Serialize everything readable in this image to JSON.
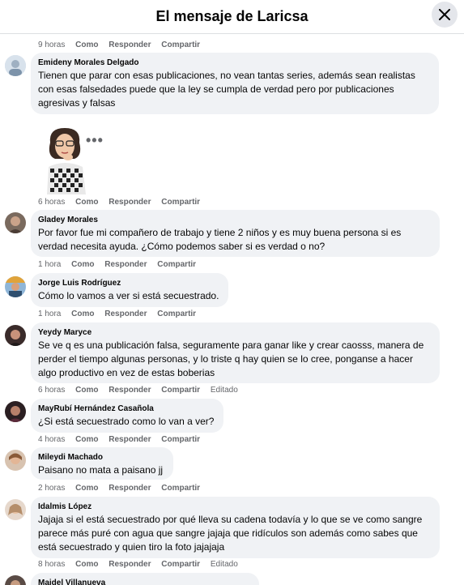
{
  "header": {
    "title": "El mensaje de Laricsa"
  },
  "comments": [
    {
      "author": "",
      "text": "",
      "time": "9 horas",
      "like": "Como",
      "reply": "Responder",
      "share": "Compartir",
      "edited": ""
    },
    {
      "author": "Emideny Morales Delgado",
      "text": "Tienen que parar con esas publicaciones, no vean tantas series, además sean realistas con esas falsedades puede que la ley se cumpla de verdad pero por publicaciones agresivas y falsas",
      "time": "6 horas",
      "like": "Como",
      "reply": "Responder",
      "share": "Compartir",
      "edited": ""
    },
    {
      "author": "Gladey Morales",
      "text": "Por favor fue mi compañero de trabajo y tiene 2 niños y es muy buena persona si es verdad necesita ayuda. ¿Cómo podemos saber si es verdad o no?",
      "time": "1 hora",
      "like": "Como",
      "reply": "Responder",
      "share": "Compartir",
      "edited": ""
    },
    {
      "author": "Jorge Luis Rodríguez",
      "text": "Cómo lo vamos a ver si está secuestrado.",
      "time": "1 hora",
      "like": "Como",
      "reply": "Responder",
      "share": "Compartir",
      "edited": ""
    },
    {
      "author": "Yeydy Maryce",
      "text": "Se ve q es una publicación falsa, seguramente para ganar like y crear caosss, manera de perder el tiempo algunas personas, y lo triste q hay quien se lo cree, ponganse a hacer algo productivo en vez de estas boberias",
      "time": "6 horas",
      "like": "Como",
      "reply": "Responder",
      "share": "Compartir",
      "edited": "Editado"
    },
    {
      "author": "MayRubí Hernández Casañola",
      "text": "¿Si está secuestrado como lo van a ver?",
      "time": "4 horas",
      "like": "Como",
      "reply": "Responder",
      "share": "Compartir",
      "edited": ""
    },
    {
      "author": "Mileydi Machado",
      "text": "Paisano no mata a paisano jj",
      "time": "2 horas",
      "like": "Como",
      "reply": "Responder",
      "share": "Compartir",
      "edited": ""
    },
    {
      "author": "Idalmis López",
      "text": "Jajaja si el está secuestrado por qué lleva su cadena todavía y lo que se ve como sangre parece más puré con agua que sangre jajaja que ridículos son además como sabes que está secuestrado y quien tiro la foto jajajaja",
      "time": "8 horas",
      "like": "Como",
      "reply": "Responder",
      "share": "Compartir",
      "edited": "Editado"
    },
    {
      "author": "Maidel Villanueva",
      "text": ""
    }
  ],
  "sticker_dots": "•••",
  "icons": {
    "close": "close-icon",
    "more": "more-options-icon"
  }
}
